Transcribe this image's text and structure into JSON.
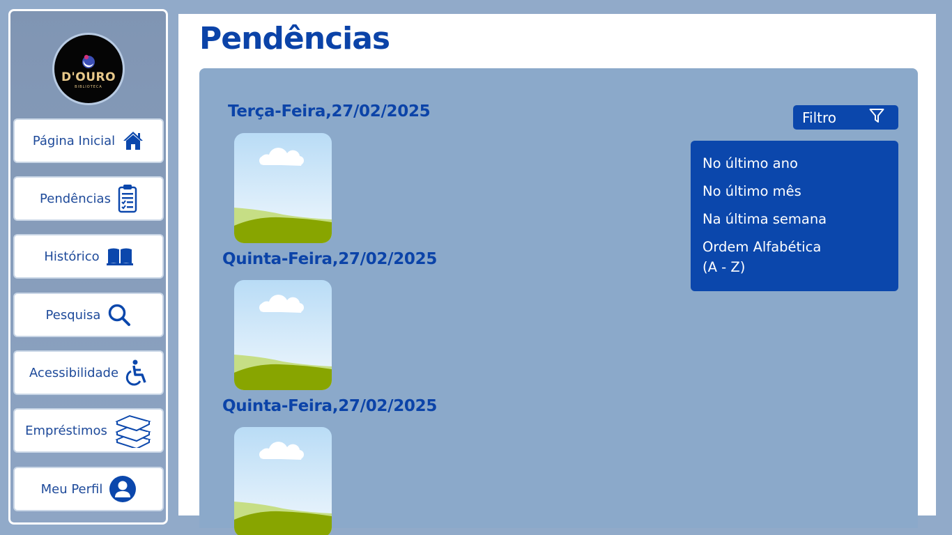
{
  "sidebar": {
    "logo": {
      "brand": "D'OURO",
      "sub": "BIBLIOTECA"
    },
    "items": [
      {
        "label": "Página Inicial",
        "icon": "home-icon"
      },
      {
        "label": "Pendências",
        "icon": "clipboard-icon"
      },
      {
        "label": "Histórico",
        "icon": "book-icon"
      },
      {
        "label": "Pesquisa",
        "icon": "search-icon"
      },
      {
        "label": "Acessibilidade",
        "icon": "wheelchair-icon"
      },
      {
        "label": "Empréstimos",
        "icon": "books-stack-icon"
      },
      {
        "label": "Meu Perfil",
        "icon": "user-icon"
      }
    ]
  },
  "main": {
    "title": "Pendências",
    "groups": [
      {
        "date": "Terça-Feira,27/02/2025",
        "thumbnail": "image-placeholder-icon"
      },
      {
        "date": "Quinta-Feira,27/02/2025",
        "thumbnail": "image-placeholder-icon"
      },
      {
        "date": "Quinta-Feira,27/02/2025",
        "thumbnail": "image-placeholder-icon"
      }
    ],
    "filter": {
      "label": "Filtro",
      "icon": "filter-icon",
      "options": [
        "No último ano",
        "No último mês",
        "Na última semana",
        "Ordem Alfabética",
        "(A - Z)"
      ]
    }
  },
  "colors": {
    "background": "#91aac9",
    "accent": "#0b47ac",
    "panel": "#8ba9ca",
    "title": "#0b43a8"
  }
}
